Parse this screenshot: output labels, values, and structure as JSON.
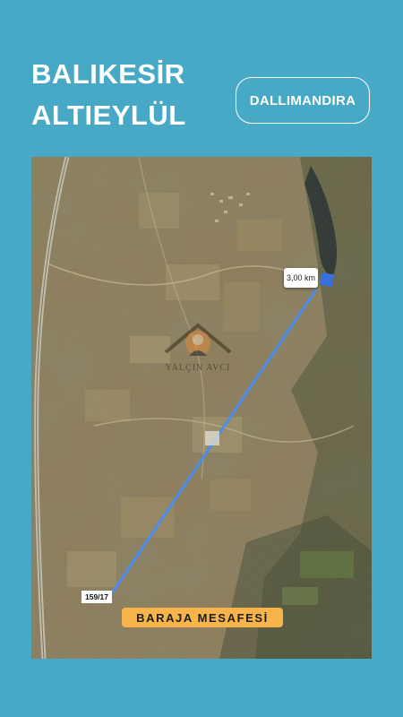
{
  "header": {
    "title_line1": "BALIKESİR",
    "title_line2": "ALTIEYLÜL",
    "location_pill": "DALLIMANDIRA"
  },
  "map": {
    "distance_label": "3,00 km",
    "parcel_label": "159/17",
    "badge_label": "BARAJA MESAFESİ",
    "watermark_text": "YALÇIN AVCI",
    "line_color": "#4a8df0",
    "badge_color": "#f6b44a"
  },
  "icons": {
    "watermark_logo": "house-roof-logo",
    "marker": "square-marker"
  },
  "colors": {
    "background": "#47a9c5",
    "text": "#ffffff"
  }
}
